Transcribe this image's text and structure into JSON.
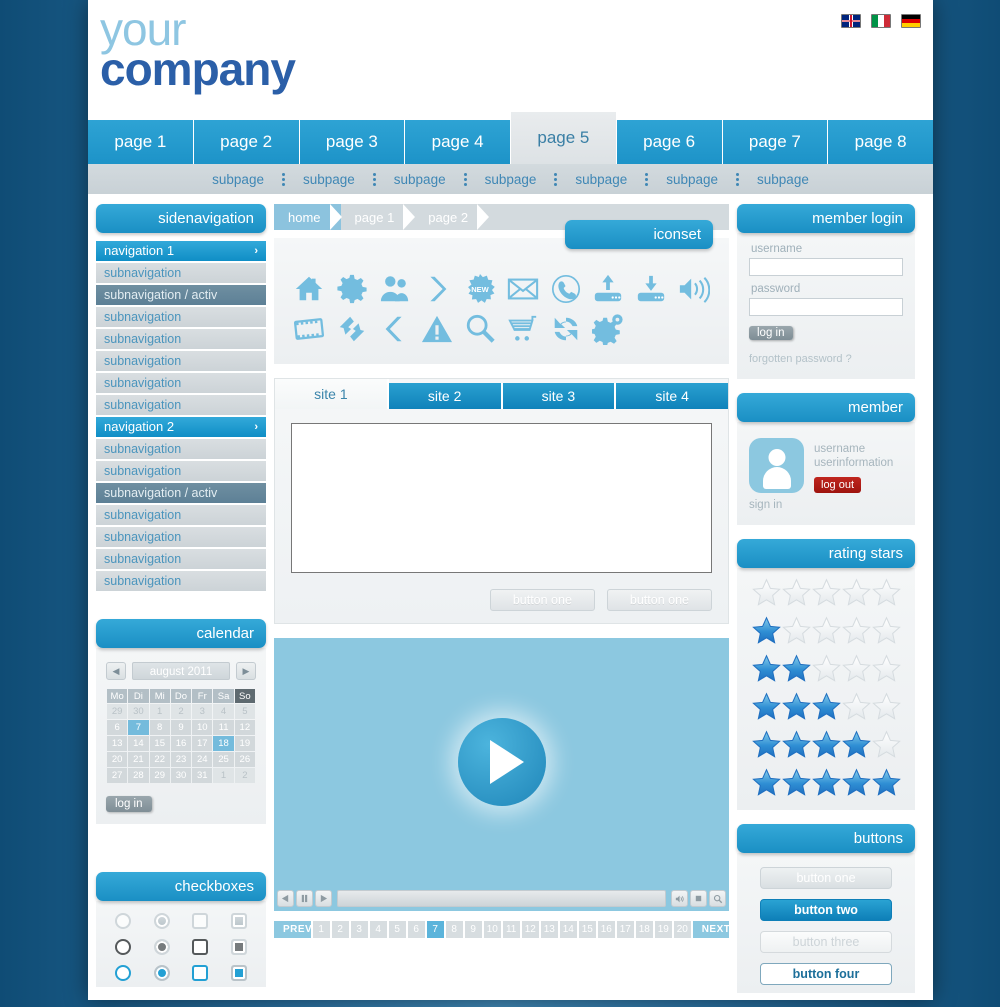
{
  "brand": {
    "line1": "your",
    "line2": "company"
  },
  "languages": [
    {
      "name": "english",
      "icon": "flag-uk-icon"
    },
    {
      "name": "italiano",
      "icon": "flag-it-icon"
    },
    {
      "name": "deutsch",
      "icon": "flag-de-icon"
    }
  ],
  "mainnav": {
    "items": [
      "page 1",
      "page 2",
      "page 3",
      "page 4",
      "page 5",
      "page 6",
      "page 7",
      "page 8"
    ],
    "active_index": 4
  },
  "subnav": {
    "items": [
      "subpage",
      "subpage",
      "subpage",
      "subpage",
      "subpage",
      "subpage",
      "subpage"
    ]
  },
  "sidenav": {
    "title": "sidenavigation",
    "chevron": "›",
    "items": [
      {
        "label": "navigation 1",
        "type": "main"
      },
      {
        "label": "subnavigation",
        "type": "sub"
      },
      {
        "label": "subnavigation / activ",
        "type": "activ"
      },
      {
        "label": "subnavigation",
        "type": "sub"
      },
      {
        "label": "subnavigation",
        "type": "sub"
      },
      {
        "label": "subnavigation",
        "type": "sub"
      },
      {
        "label": "subnavigation",
        "type": "sub"
      },
      {
        "label": "subnavigation",
        "type": "sub"
      },
      {
        "label": "navigation 2",
        "type": "main"
      },
      {
        "label": "subnavigation",
        "type": "sub"
      },
      {
        "label": "subnavigation",
        "type": "sub"
      },
      {
        "label": "subnavigation / activ",
        "type": "activ"
      },
      {
        "label": "subnavigation",
        "type": "sub"
      },
      {
        "label": "subnavigation",
        "type": "sub"
      },
      {
        "label": "subnavigation",
        "type": "sub"
      },
      {
        "label": "subnavigation",
        "type": "sub"
      }
    ]
  },
  "calendar": {
    "title": "calendar",
    "month": "august 2011",
    "prev": "◀",
    "next": "▶",
    "weekdays": [
      "Mo",
      "Di",
      "Mi",
      "Do",
      "Fr",
      "Sa",
      "So"
    ],
    "weeks": [
      [
        {
          "d": "29",
          "s": "mute"
        },
        {
          "d": "30",
          "s": "mute"
        },
        {
          "d": "1",
          "s": "mute"
        },
        {
          "d": "2",
          "s": "mute"
        },
        {
          "d": "3",
          "s": "mute"
        },
        {
          "d": "4",
          "s": "mute"
        },
        {
          "d": "5",
          "s": "mute"
        }
      ],
      [
        {
          "d": "6",
          "s": ""
        },
        {
          "d": "7",
          "s": "hl"
        },
        {
          "d": "8",
          "s": ""
        },
        {
          "d": "9",
          "s": ""
        },
        {
          "d": "10",
          "s": ""
        },
        {
          "d": "11",
          "s": ""
        },
        {
          "d": "12",
          "s": ""
        }
      ],
      [
        {
          "d": "13",
          "s": ""
        },
        {
          "d": "14",
          "s": ""
        },
        {
          "d": "15",
          "s": ""
        },
        {
          "d": "16",
          "s": ""
        },
        {
          "d": "17",
          "s": ""
        },
        {
          "d": "18",
          "s": "hl"
        },
        {
          "d": "19",
          "s": ""
        }
      ],
      [
        {
          "d": "20",
          "s": ""
        },
        {
          "d": "21",
          "s": ""
        },
        {
          "d": "22",
          "s": ""
        },
        {
          "d": "23",
          "s": ""
        },
        {
          "d": "24",
          "s": ""
        },
        {
          "d": "25",
          "s": ""
        },
        {
          "d": "26",
          "s": ""
        }
      ],
      [
        {
          "d": "27",
          "s": ""
        },
        {
          "d": "28",
          "s": ""
        },
        {
          "d": "29",
          "s": ""
        },
        {
          "d": "30",
          "s": ""
        },
        {
          "d": "31",
          "s": ""
        },
        {
          "d": "1",
          "s": "mute"
        },
        {
          "d": "2",
          "s": "mute"
        }
      ]
    ],
    "login_label": "log in"
  },
  "checkboxes": {
    "title": "checkboxes",
    "rows": [
      [
        {
          "type": "radio",
          "style": "g-light",
          "filled": false
        },
        {
          "type": "radio",
          "style": "g-light",
          "filled": true
        },
        {
          "type": "box",
          "style": "g-light",
          "filled": false
        },
        {
          "type": "box",
          "style": "g-light",
          "filled": true
        }
      ],
      [
        {
          "type": "radio",
          "style": "g-dark",
          "filled": false
        },
        {
          "type": "radio",
          "style": "g-dark",
          "filled": true
        },
        {
          "type": "box",
          "style": "g-dark",
          "filled": false
        },
        {
          "type": "box",
          "style": "g-dark",
          "filled": true
        }
      ],
      [
        {
          "type": "radio",
          "style": "g-blue",
          "filled": false
        },
        {
          "type": "radio",
          "style": "g-blue",
          "filled": true
        },
        {
          "type": "box",
          "style": "g-blue",
          "filled": false
        },
        {
          "type": "box",
          "style": "g-blue",
          "filled": true
        }
      ]
    ]
  },
  "breadcrumb": {
    "items": [
      "home",
      "page 1",
      "page 2"
    ],
    "active_index": 0
  },
  "iconset": {
    "title": "iconset",
    "icons": [
      "home-icon",
      "gear-icon",
      "users-icon",
      "chevron-right-icon",
      "new-badge-icon",
      "mail-icon",
      "phone-icon",
      "upload-icon",
      "download-icon",
      "speaker-icon",
      "film-icon",
      "transfer-arrows-icon",
      "chevron-left-icon",
      "warning-icon",
      "search-icon",
      "cart-icon",
      "refresh-icon",
      "gears-icon"
    ]
  },
  "tabpanel": {
    "tabs": [
      "site 1",
      "site 2",
      "site 3",
      "site 4"
    ],
    "active_index": 0,
    "buttons": [
      "button one",
      "button one"
    ]
  },
  "video": {
    "play_label": "play",
    "controls": [
      "rewind-icon",
      "pause-icon",
      "play-icon",
      "volume-icon",
      "stop-icon",
      "zoom-icon"
    ]
  },
  "pagination": {
    "prev": "PREV",
    "next": "NEXT",
    "pages": [
      "1",
      "2",
      "3",
      "4",
      "5",
      "6",
      "7",
      "8",
      "9",
      "10",
      "11",
      "12",
      "13",
      "14",
      "15",
      "16",
      "17",
      "18",
      "19",
      "20"
    ],
    "active": "7"
  },
  "member_login": {
    "title": "member login",
    "username_label": "username",
    "username_value": "",
    "password_label": "password",
    "password_value": "",
    "login_label": "log in",
    "forgot_label": "forgotten password ?"
  },
  "member": {
    "title": "member",
    "username": "username",
    "userinfo": "userinformation",
    "logout_label": "log out",
    "signin_label": "sign in"
  },
  "rating": {
    "title": "rating stars",
    "rows": [
      0,
      1,
      2,
      3,
      4,
      5
    ],
    "max": 5
  },
  "buttons": {
    "title": "buttons",
    "items": [
      {
        "label": "button one",
        "style": "b1"
      },
      {
        "label": "button two",
        "style": "b2"
      },
      {
        "label": "button three",
        "style": "b3"
      },
      {
        "label": "button four",
        "style": "b4"
      }
    ]
  },
  "colors": {
    "accent": "#1d93c8",
    "accent_light": "#8cc8e0",
    "brand_dark": "#2b5fa8",
    "brand_light": "#8ec6e2",
    "danger": "#b01c16",
    "panel": "#eceff1",
    "nav_grey": "#d3dade"
  }
}
